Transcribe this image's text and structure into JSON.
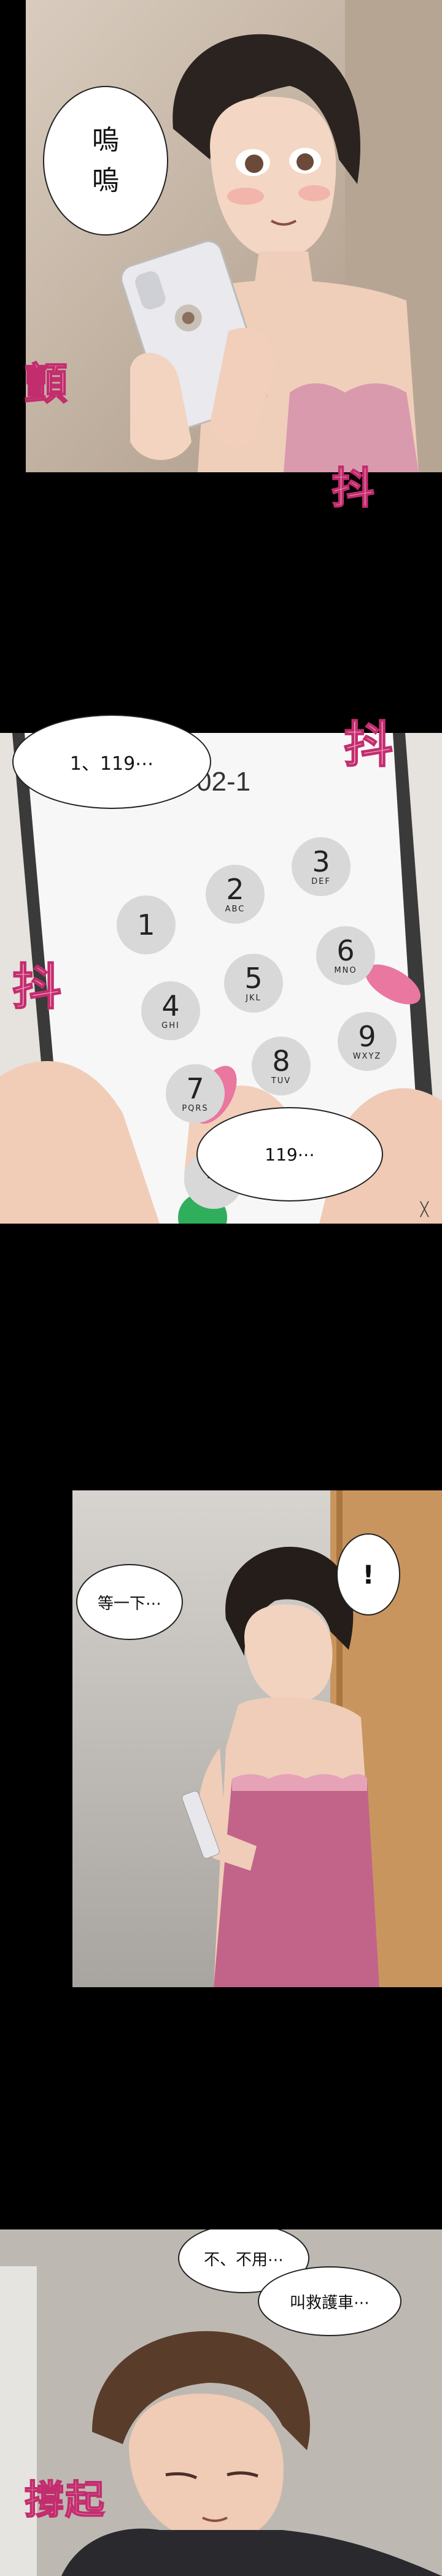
{
  "panel1": {
    "bubble_sobbing": "嗚\n嗚",
    "sfx_tremble": "顫",
    "sfx_shake": "抖"
  },
  "panel2": {
    "bubble_top": "1、119⋯",
    "sfx_shake_top": "抖",
    "sfx_shake_left": "抖",
    "dial_display": "02-1",
    "keys": [
      {
        "num": "1",
        "sub": ""
      },
      {
        "num": "2",
        "sub": "ABC"
      },
      {
        "num": "3",
        "sub": "DEF"
      },
      {
        "num": "4",
        "sub": "GHI"
      },
      {
        "num": "5",
        "sub": "JKL"
      },
      {
        "num": "6",
        "sub": "MNO"
      },
      {
        "num": "7",
        "sub": "PQRS"
      },
      {
        "num": "8",
        "sub": "TUV"
      },
      {
        "num": "9",
        "sub": "WXYZ"
      },
      {
        "num": "*",
        "sub": ""
      }
    ],
    "bubble_bottom": "119⋯",
    "close_glyph": "╳"
  },
  "panel3": {
    "bubble_wait": "等一下⋯",
    "bubble_exclaim": "!"
  },
  "panel4": {
    "bubble_no": "不、不用⋯",
    "bubble_ambulance": "叫救護車⋯",
    "sfx_support": "撐起"
  }
}
